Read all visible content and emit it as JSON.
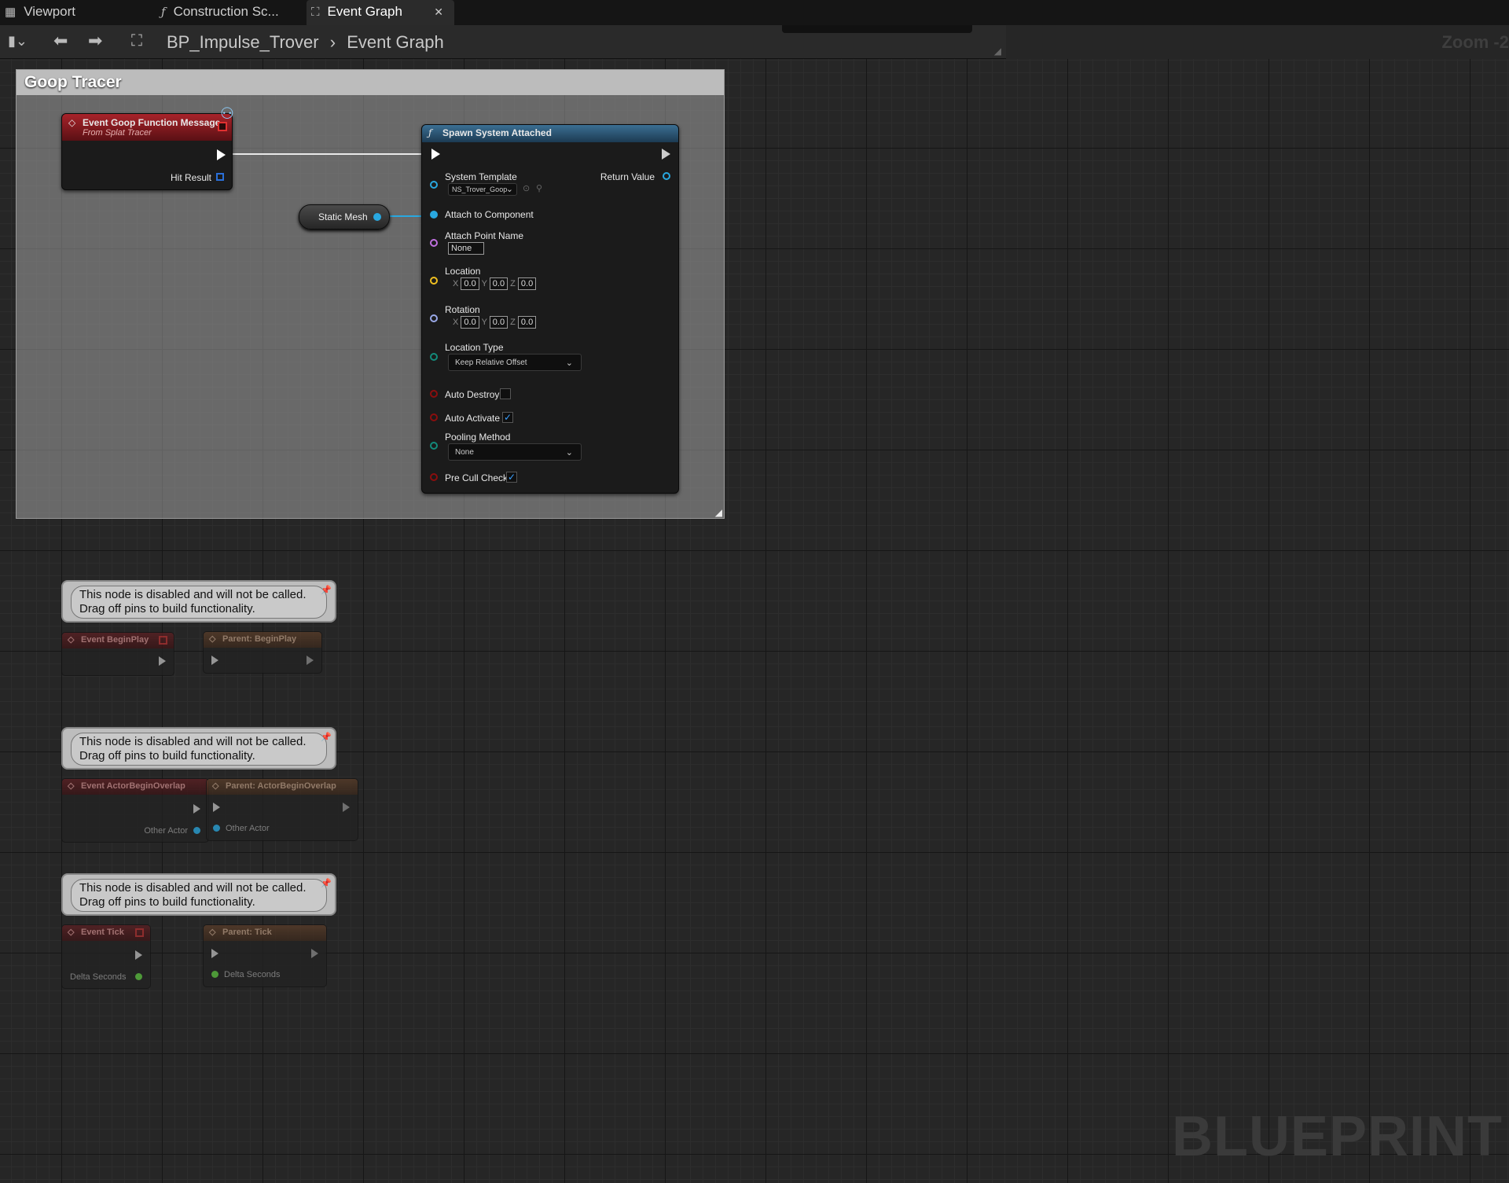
{
  "tabs": [
    {
      "label": "Viewport",
      "icon": "viewport-icon"
    },
    {
      "label": "Construction Sc...",
      "icon": "function-icon"
    },
    {
      "label": "Event Graph",
      "icon": "graph-icon"
    }
  ],
  "close_glyph": "✕",
  "breadcrumb": {
    "blueprint": "BP_Impulse_Trover",
    "separator": "›",
    "graph": "Event Graph"
  },
  "zoom_label": "Zoom -2",
  "watermark": "BLUEPRINT",
  "comment_title": "Goop Tracer",
  "event_node": {
    "title": "Event Goop Function Message",
    "subtitle": "From Splat Tracer",
    "pin_hit_result": "Hit Result"
  },
  "static_mesh_label": "Static Mesh",
  "spawn_node": {
    "title": "Spawn System Attached",
    "system_template_label": "System Template",
    "system_template_value": "NS_Trover_Goop",
    "return_value_label": "Return Value",
    "attach_to_component": "Attach to Component",
    "attach_point_name": "Attach Point Name",
    "attach_point_value": "None",
    "location_label": "Location",
    "rotation_label": "Rotation",
    "axis_x": "X",
    "axis_y": "Y",
    "axis_z": "Z",
    "location": {
      "x": "0.0",
      "y": "0.0",
      "z": "0.0"
    },
    "rotation": {
      "x": "0.0",
      "y": "0.0",
      "z": "0.0"
    },
    "location_type_label": "Location Type",
    "location_type_value": "Keep Relative Offset",
    "auto_destroy": "Auto Destroy",
    "auto_destroy_checked": false,
    "auto_activate": "Auto Activate",
    "auto_activate_checked": true,
    "pooling_method_label": "Pooling Method",
    "pooling_method_value": "None",
    "pre_cull_check": "Pre Cull Check",
    "pre_cull_checked": true
  },
  "disabled_message_line1": "This node is disabled and will not be called.",
  "disabled_message_line2": "Drag off pins to build functionality.",
  "disabled_groups": [
    {
      "event": "Event BeginPlay",
      "parent": "Parent: BeginPlay",
      "event_pin": "",
      "parent_pin": ""
    },
    {
      "event": "Event ActorBeginOverlap",
      "parent": "Parent: ActorBeginOverlap",
      "event_pin": "Other Actor",
      "parent_pin": "Other Actor"
    },
    {
      "event": "Event Tick",
      "parent": "Parent: Tick",
      "event_pin": "Delta Seconds",
      "parent_pin": "Delta Seconds"
    }
  ],
  "colors": {
    "event_red": "#a8232a",
    "function_blue": "#3b6f93",
    "object_pin": "#29a8e0",
    "float_pin": "#6fd84f"
  }
}
